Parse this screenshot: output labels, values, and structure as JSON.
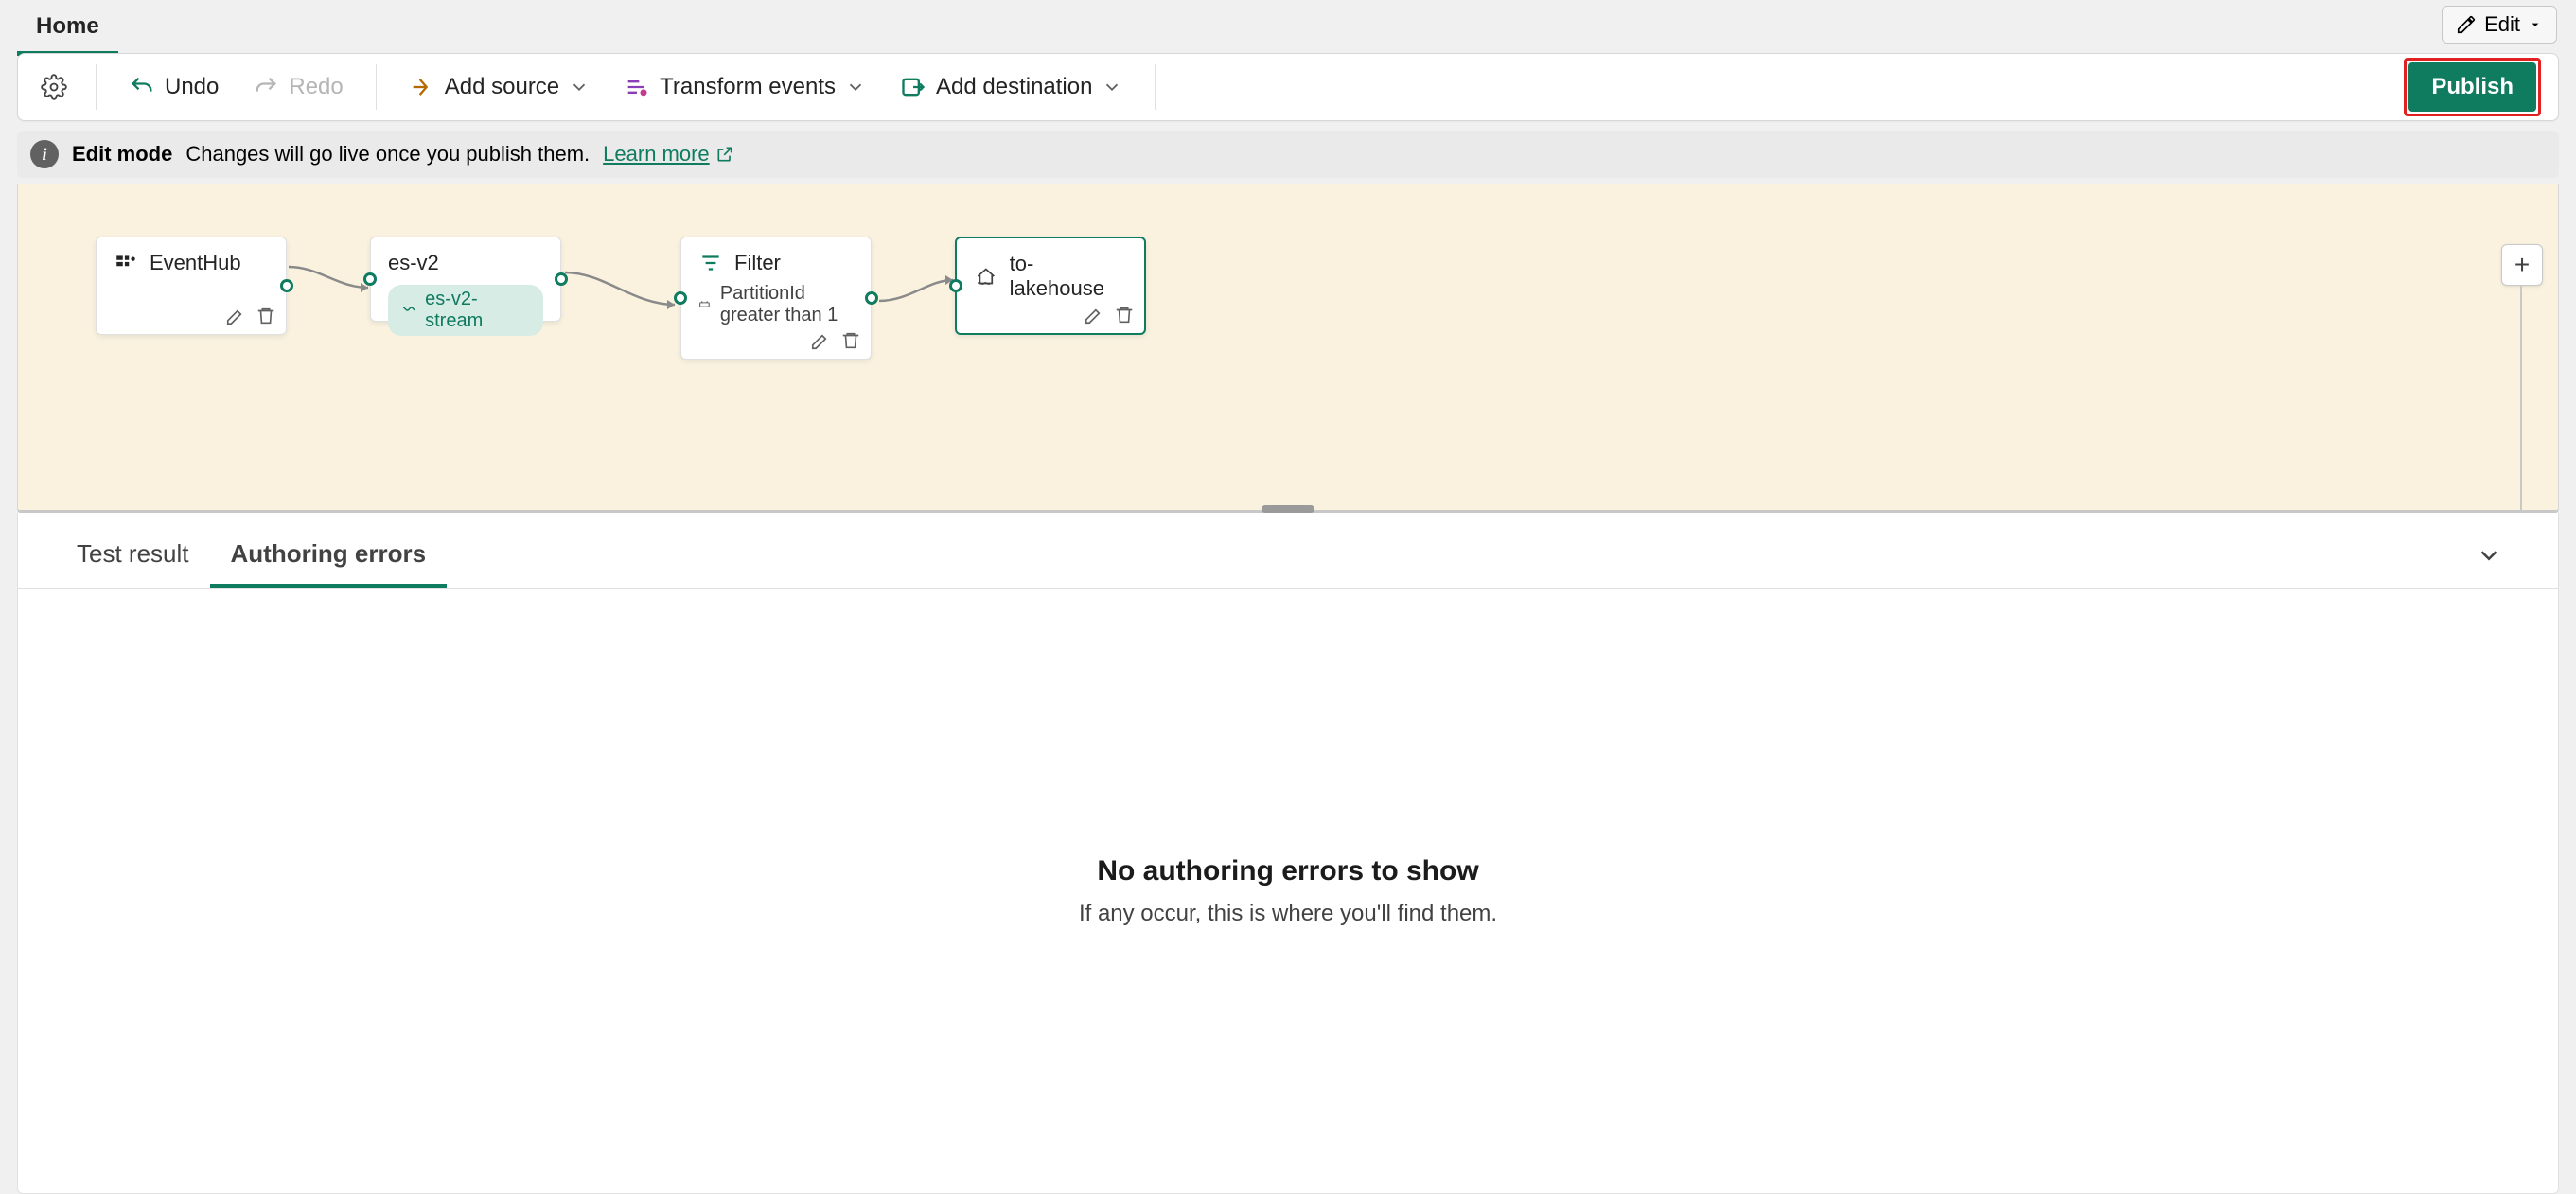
{
  "topTabs": {
    "home": "Home"
  },
  "editMenu": {
    "label": "Edit"
  },
  "toolbar": {
    "undo": "Undo",
    "redo": "Redo",
    "addSource": "Add source",
    "transform": "Transform events",
    "addDestination": "Add destination",
    "publish": "Publish"
  },
  "info": {
    "mode": "Edit mode",
    "message": "Changes will go live once you publish them.",
    "learnMore": "Learn more"
  },
  "nodes": {
    "source": {
      "title": "EventHub"
    },
    "stream": {
      "title": "es-v2",
      "chip": "es-v2-stream"
    },
    "filter": {
      "title": "Filter",
      "condition": "PartitionId greater than 1"
    },
    "dest": {
      "title": "to-lakehouse"
    }
  },
  "panel": {
    "tabs": {
      "test": "Test result",
      "errors": "Authoring errors"
    },
    "emptyTitle": "No authoring errors to show",
    "emptySub": "If any occur, this is where you'll find them."
  }
}
